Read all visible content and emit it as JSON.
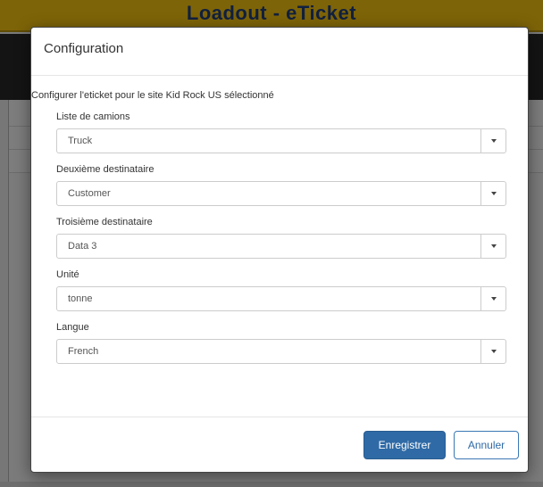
{
  "app": {
    "title": "Loadout - eTicket"
  },
  "modal": {
    "title": "Configuration",
    "intro": "Configurer l'eticket pour le site Kid Rock US sélectionné",
    "fields": [
      {
        "label": "Liste de camions",
        "value": "Truck"
      },
      {
        "label": "Deuxième destinataire",
        "value": "Customer"
      },
      {
        "label": "Troisième destinataire",
        "value": "Data 3"
      },
      {
        "label": "Unité",
        "value": "tonne"
      },
      {
        "label": "Langue",
        "value": "French"
      }
    ],
    "save_label": "Enregistrer",
    "cancel_label": "Annuler"
  },
  "colors": {
    "titlebar": "#7e6408",
    "navbar": "#141414",
    "primary": "#2f6aa6"
  }
}
